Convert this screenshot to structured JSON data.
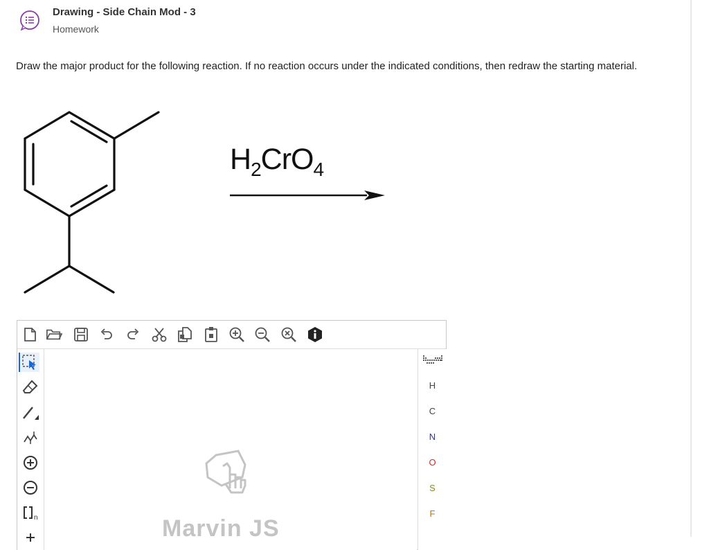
{
  "header": {
    "title": "Drawing - Side Chain Mod - 3",
    "subtitle": "Homework",
    "icon": "list-bubble-icon",
    "icon_color": "#8a3ea5"
  },
  "question": {
    "text": "Draw the major product for the following reaction. If no reaction occurs under the indicated conditions, then redraw the starting material."
  },
  "reaction": {
    "reagent_main": "H",
    "reagent_sub1": "2",
    "reagent_mid": "CrO",
    "reagent_sub2": "4"
  },
  "editor": {
    "top_toolbar": [
      "new-document-icon",
      "open-folder-icon",
      "save-icon",
      "undo-icon",
      "redo-icon",
      "cut-icon",
      "copy-icon",
      "paste-icon",
      "zoom-in-icon",
      "zoom-out-icon",
      "zoom-reset-icon",
      "info-icon"
    ],
    "left_toolbar": [
      "select-arrow-icon",
      "eraser-icon",
      "single-bond-icon",
      "chain-icon",
      "positive-charge-icon",
      "negative-charge-icon",
      "bracket-n-icon"
    ],
    "bracket_label": "n",
    "elements": [
      {
        "symbol": "H",
        "color": "#444444"
      },
      {
        "symbol": "C",
        "color": "#444444"
      },
      {
        "symbol": "N",
        "color": "#2c2ccc"
      },
      {
        "symbol": "O",
        "color": "#d42a2a"
      },
      {
        "symbol": "S",
        "color": "#8a8a1a"
      },
      {
        "symbol": "F",
        "color": "#b07a1a"
      }
    ],
    "watermark": "Marvin JS",
    "accent": "#1a66d8"
  }
}
